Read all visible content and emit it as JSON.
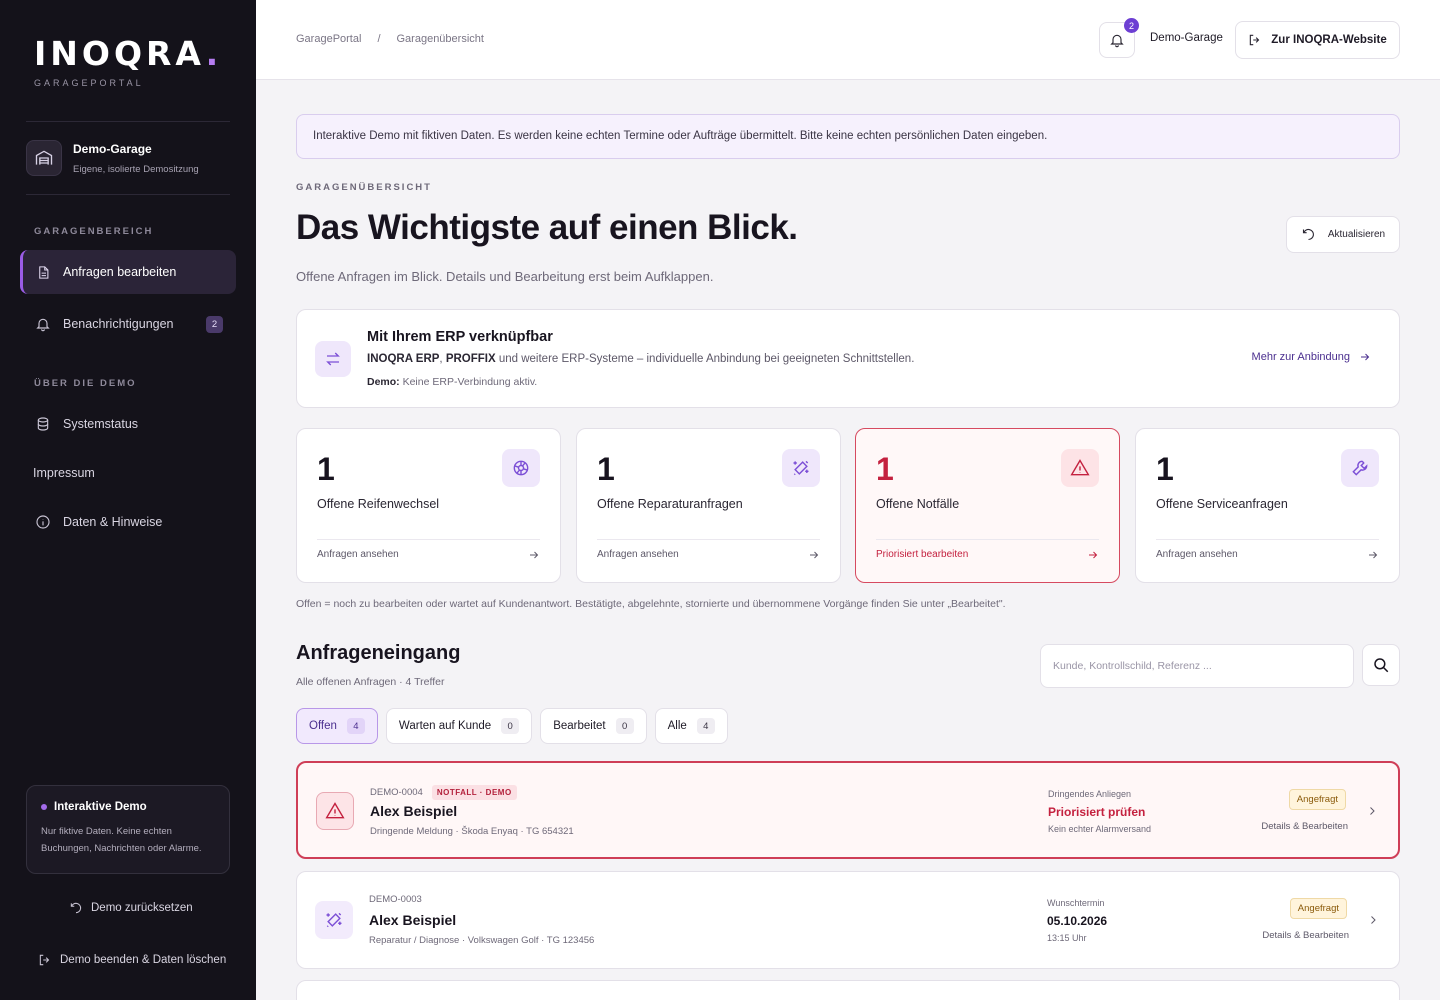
{
  "sidebar": {
    "logo": "INOQRA",
    "logo_dot": ".",
    "logo_sub": "GARAGEPORTAL",
    "garage": {
      "name": "Demo-Garage",
      "desc": "Eigene, isolierte Demositzung"
    },
    "section1": "GARAGENBEREICH",
    "nav": [
      {
        "label": "Anfragen bearbeiten",
        "icon": "document-icon",
        "active": true
      },
      {
        "label": "Benachrichtigungen",
        "icon": "bell-icon",
        "badge": "2"
      }
    ],
    "section2": "ÜBER DIE DEMO",
    "nav2": [
      {
        "label": "Systemstatus",
        "icon": "database-icon"
      },
      {
        "label": "Impressum"
      },
      {
        "label": "Daten & Hinweise",
        "icon": "info-icon"
      }
    ],
    "demo_box": {
      "title": "Interaktive Demo",
      "text": "Nur fiktive Daten. Keine echten Buchungen, Nachrichten oder Alarme."
    },
    "reset_label": "Demo zurücksetzen",
    "exit_label": "Demo beenden & Daten löschen"
  },
  "topbar": {
    "breadcrumb": [
      "GaragePortal",
      "/",
      "Garagenübersicht"
    ],
    "bell_count": "2",
    "garage_name": "Demo-Garage",
    "site_button": "Zur INOQRA-Website"
  },
  "main": {
    "notice": "Interaktive Demo mit fiktiven Daten. Es werden keine echten Termine oder Aufträge übermittelt. Bitte keine echten persönlichen Daten eingeben.",
    "eyebrow": "GARAGENÜBERSICHT",
    "title": "Das Wichtigste auf einen Blick.",
    "subtitle": "Offene Anfragen im Blick. Details und Bearbeitung erst beim Aufklappen.",
    "refresh_label": "Aktualisieren",
    "erp": {
      "title": "Mit Ihrem ERP verknüpfbar",
      "text_b1": "INOQRA ERP",
      "text_sep": ", ",
      "text_b2": "PROFFIX",
      "text_rest": " und weitere ERP-Systeme – individuelle Anbindung bei geeigneten Schnittstellen.",
      "demo_b": "Demo:",
      "demo_rest": " Keine ERP-Verbindung aktiv.",
      "link": "Mehr zur Anbindung"
    },
    "stats": [
      {
        "num": "1",
        "label": "Offene Reifenwechsel",
        "link": "Anfragen ansehen",
        "icon": "tire-icon"
      },
      {
        "num": "1",
        "label": "Offene Reparaturanfragen",
        "link": "Anfragen ansehen",
        "icon": "repair-icon"
      },
      {
        "num": "1",
        "label": "Offene Notfälle",
        "link": "Priorisiert bearbeiten",
        "icon": "warning-icon"
      },
      {
        "num": "1",
        "label": "Offene Serviceanfragen",
        "link": "Anfragen ansehen",
        "icon": "wrench-icon"
      }
    ],
    "footnote": "Offen = noch zu bearbeiten oder wartet auf Kundenantwort. Bestätigte, abgelehnte, stornierte und übernommene Vorgänge finden Sie unter „Bearbeitet\".",
    "inbox": {
      "title": "Anfrageneingang",
      "subtitle": "Alle offenen Anfragen · 4 Treffer",
      "search_placeholder": "Kunde, Kontrollschild, Referenz ...",
      "filters": [
        {
          "label": "Offen",
          "count": "4",
          "active": true
        },
        {
          "label": "Warten auf Kunde",
          "count": "0"
        },
        {
          "label": "Bearbeitet",
          "count": "0"
        },
        {
          "label": "Alle",
          "count": "4"
        }
      ],
      "rows": [
        {
          "ref": "DEMO-0004",
          "tag": "NOTFALL · DEMO",
          "name": "Alex Beispiel",
          "meta": "Dringende Meldung · Škoda Enyaq · TG 654321",
          "mid_label": "Dringendes Anliegen",
          "mid_value": "Priorisiert prüfen",
          "mid_sub": "Kein echter Alarmversand",
          "status": "Angefragt",
          "details": "Details & Bearbeiten"
        },
        {
          "ref": "DEMO-0003",
          "name": "Alex Beispiel",
          "meta": "Reparatur / Diagnose · Volkswagen Golf · TG 123456",
          "mid_label": "Wunschtermin",
          "mid_value": "05.10.2026",
          "mid_sub": "13:15 Uhr",
          "status": "Angefragt",
          "details": "Details & Bearbeiten"
        }
      ]
    }
  },
  "colors": {
    "accent": "#9a5ce6",
    "alert": "#c4213f",
    "sidebar_bg": "#14121a"
  }
}
